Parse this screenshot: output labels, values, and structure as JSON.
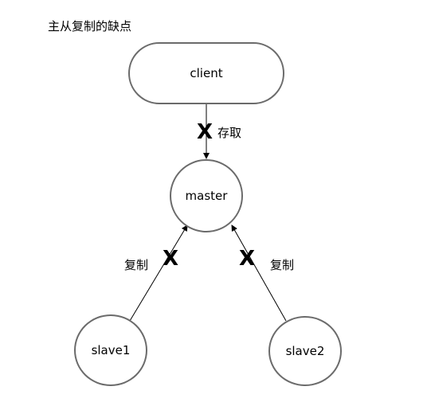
{
  "title": "主从复制的缺点",
  "nodes": {
    "client": "client",
    "master": "master",
    "slave1": "slave1",
    "slave2": "slave2"
  },
  "edges": {
    "client_master": {
      "label": "存取",
      "mark": "X"
    },
    "slave1_master": {
      "label": "复制",
      "mark": "X"
    },
    "slave2_master": {
      "label": "复制",
      "mark": "X"
    }
  },
  "colors": {
    "node_border": "#6b6b6b",
    "edge": "#000000",
    "text": "#000000"
  }
}
